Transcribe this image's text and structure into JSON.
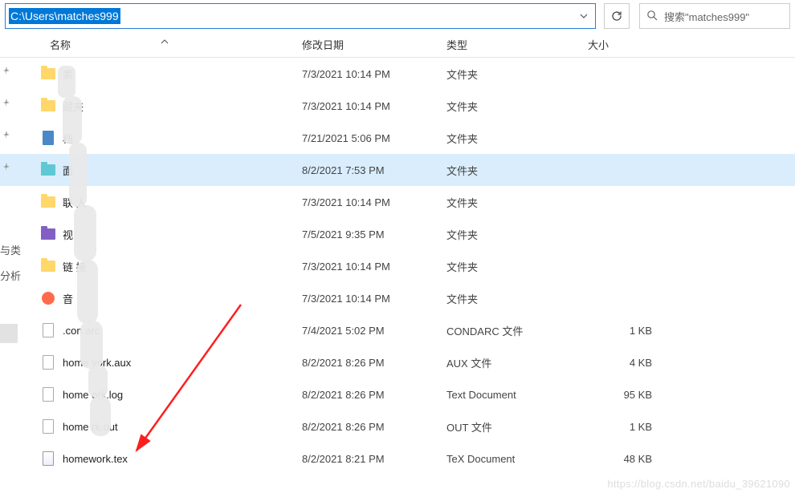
{
  "address": {
    "path": "C:\\Users\\matches999"
  },
  "search": {
    "placeholder": "搜索\"matches999\""
  },
  "columns": {
    "name": "名称",
    "date": "修改日期",
    "type": "类型",
    "size": "大小"
  },
  "side": {
    "crumb1": "与类",
    "crumb2": "分析"
  },
  "rows": [
    {
      "icon": "folder",
      "name": "索",
      "date": "7/3/2021 10:14 PM",
      "type": "文件夹",
      "size": ""
    },
    {
      "icon": "folder",
      "name": "藏夹",
      "date": "7/3/2021 10:14 PM",
      "type": "文件夹",
      "size": ""
    },
    {
      "icon": "doc",
      "name": "档",
      "date": "7/21/2021 5:06 PM",
      "type": "文件夹",
      "size": ""
    },
    {
      "icon": "teal",
      "name": "面",
      "date": "8/2/2021 7:53 PM",
      "type": "文件夹",
      "size": "",
      "selected": true
    },
    {
      "icon": "folder",
      "name": "联    人",
      "date": "7/3/2021 10:14 PM",
      "type": "文件夹",
      "size": ""
    },
    {
      "icon": "purple",
      "name": "视",
      "date": "7/5/2021 9:35 PM",
      "type": "文件夹",
      "size": ""
    },
    {
      "icon": "folder",
      "name": "链  接",
      "date": "7/3/2021 10:14 PM",
      "type": "文件夹",
      "size": ""
    },
    {
      "icon": "music",
      "name": "音",
      "date": "7/3/2021 10:14 PM",
      "type": "文件夹",
      "size": ""
    },
    {
      "icon": "file",
      "name": ".con    arc",
      "date": "7/4/2021 5:02 PM",
      "type": "CONDARC 文件",
      "size": "1 KB"
    },
    {
      "icon": "file",
      "name": "home  vork.aux",
      "date": "8/2/2021 8:26 PM",
      "type": "AUX 文件",
      "size": "4 KB"
    },
    {
      "icon": "file",
      "name": "home  ork.log",
      "date": "8/2/2021 8:26 PM",
      "type": "Text Document",
      "size": "95 KB"
    },
    {
      "icon": "file",
      "name": "home    rk.out",
      "date": "8/2/2021 8:26 PM",
      "type": "OUT 文件",
      "size": "1 KB"
    },
    {
      "icon": "tex",
      "name": "homework.tex",
      "date": "8/2/2021 8:21 PM",
      "type": "TeX Document",
      "size": "48 KB"
    }
  ],
  "watermark": "https://blog.csdn.net/baidu_39621090"
}
